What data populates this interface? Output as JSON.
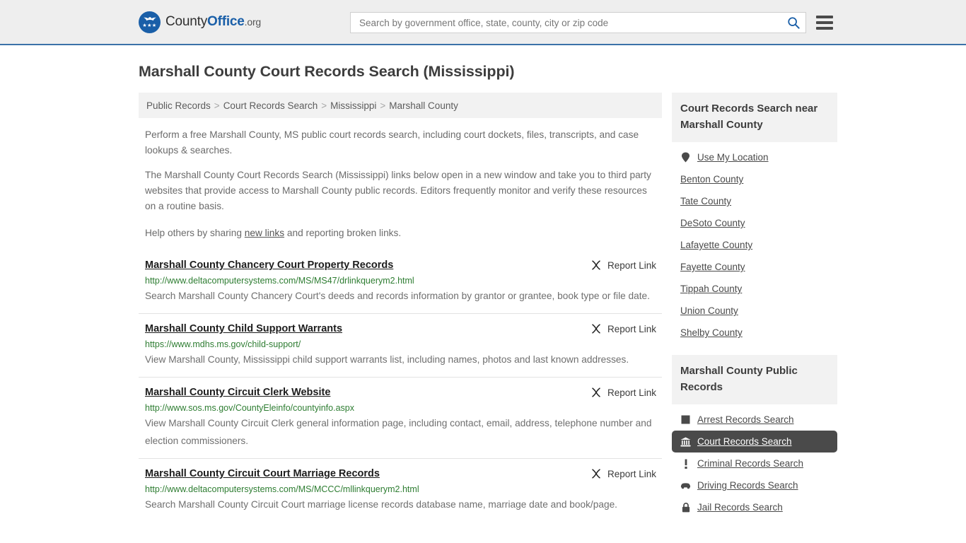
{
  "header": {
    "logo": {
      "name_part1": "County",
      "name_part2": "Office",
      "tld": ".org",
      "stars": "★★★"
    },
    "search": {
      "placeholder": "Search by government office, state, county, city or zip code",
      "value": "",
      "icon": "search-icon"
    },
    "menu_icon": "hamburger-menu-icon"
  },
  "page": {
    "title": "Marshall County Court Records Search (Mississippi)"
  },
  "breadcrumb": {
    "separator": ">",
    "items": [
      {
        "label": "Public Records"
      },
      {
        "label": "Court Records Search"
      },
      {
        "label": "Mississippi"
      },
      {
        "label": "Marshall County"
      }
    ]
  },
  "intro": {
    "p1": "Perform a free Marshall County, MS public court records search, including court dockets, files, transcripts, and case lookups & searches.",
    "p2": "The Marshall County Court Records Search (Mississippi) links below open in a new window and take you to third party websites that provide access to Marshall County public records. Editors frequently monitor and verify these resources on a routine basis.",
    "p3_before": "Help others by sharing ",
    "p3_link": "new links",
    "p3_after": " and reporting broken links."
  },
  "results": {
    "report_label": "Report Link",
    "report_icon": "unlink-icon",
    "items": [
      {
        "title": "Marshall County Chancery Court Property Records",
        "url": "http://www.deltacomputersystems.com/MS/MS47/drlinkquerym2.html",
        "description": "Search Marshall County Chancery Court's deeds and records information by grantor or grantee, book type or file date."
      },
      {
        "title": "Marshall County Child Support Warrants",
        "url": "https://www.mdhs.ms.gov/child-support/",
        "description": "View Marshall County, Mississippi child support warrants list, including names, photos and last known addresses."
      },
      {
        "title": "Marshall County Circuit Clerk Website",
        "url": "http://www.sos.ms.gov/CountyEleinfo/countyinfo.aspx",
        "description": "View Marshall County Circuit Clerk general information page, including contact, email, address, telephone number and election commissioners."
      },
      {
        "title": "Marshall County Circuit Court Marriage Records",
        "url": "http://www.deltacomputersystems.com/MS/MCCC/mllinkquerym2.html",
        "description": "Search Marshall County Circuit Court marriage license records database name, marriage date and book/page."
      }
    ]
  },
  "sidebar": {
    "nearby": {
      "heading": "Court Records Search near Marshall County",
      "items": [
        {
          "label": "Use My Location",
          "icon": "map-pin-icon"
        },
        {
          "label": "Benton County",
          "icon": ""
        },
        {
          "label": "Tate County",
          "icon": ""
        },
        {
          "label": "DeSoto County",
          "icon": ""
        },
        {
          "label": "Lafayette County",
          "icon": ""
        },
        {
          "label": "Fayette County",
          "icon": ""
        },
        {
          "label": "Tippah County",
          "icon": ""
        },
        {
          "label": "Union County",
          "icon": ""
        },
        {
          "label": "Shelby County",
          "icon": ""
        }
      ]
    },
    "public_records": {
      "heading": "Marshall County Public Records",
      "items": [
        {
          "label": "Arrest Records Search",
          "icon": "fingerprint-icon",
          "active": false
        },
        {
          "label": "Court Records Search",
          "icon": "courthouse-icon",
          "active": true
        },
        {
          "label": "Criminal Records Search",
          "icon": "exclamation-icon",
          "active": false
        },
        {
          "label": "Driving Records Search",
          "icon": "car-icon",
          "active": false
        },
        {
          "label": "Jail Records Search",
          "icon": "lock-icon",
          "active": false
        }
      ]
    }
  },
  "colors": {
    "brand_blue": "#1a5fa8",
    "header_bg": "#eeeeee",
    "header_border": "#3b72a8",
    "url_green": "#2e7d32",
    "active_bg": "#4a4a4a",
    "panel_bg": "#f2f2f2"
  }
}
